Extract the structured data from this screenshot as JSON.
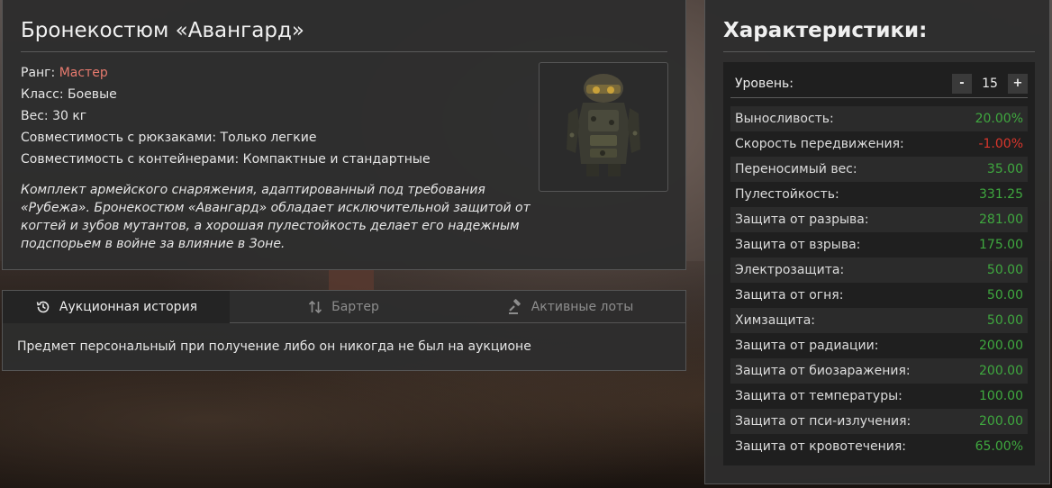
{
  "item": {
    "title": "Бронекостюм «Авангард»",
    "rank_label": "Ранг: ",
    "rank_value": "Мастер",
    "class_line": "Класс: Боевые",
    "weight_line": "Вес: 30 кг",
    "backpack_line": "Совместимость с рюкзаками: Только легкие",
    "container_line": "Совместимость с контейнерами: Компактные и стандартные",
    "description": "Комплект армейского снаряжения, адаптированный под требования «Рубежа». Бронекостюм «Авангард» обладает исключительной защитой от когтей и зубов мутантов, а хорошая пулестойкость делает его надежным подспорьем в войне за влияние в Зоне.",
    "image_icon": "armor-suit-icon"
  },
  "tabs": {
    "items": [
      {
        "label": "Аукционная история",
        "icon": "history-icon",
        "active": true
      },
      {
        "label": "Бартер",
        "icon": "swap-arrows-icon",
        "active": false
      },
      {
        "label": "Активные лоты",
        "icon": "gavel-icon",
        "active": false
      }
    ],
    "content": "Предмет персональный при получение либо он никогда не был на аукционе"
  },
  "characteristics": {
    "title": "Характеристики:",
    "level_label": "Уровень:",
    "level_value": "15",
    "minus_label": "-",
    "plus_label": "+",
    "stats": [
      {
        "name": "Выносливость:",
        "value": "20.00%"
      },
      {
        "name": "Скорость передвижения:",
        "value": "-1.00%"
      },
      {
        "name": "Переносимый вес:",
        "value": "35.00"
      },
      {
        "name": "Пулестойкость:",
        "value": "331.25"
      },
      {
        "name": "Защита от разрыва:",
        "value": "281.00"
      },
      {
        "name": "Защита от взрыва:",
        "value": "175.00"
      },
      {
        "name": "Электрозащита:",
        "value": "50.00"
      },
      {
        "name": "Защита от огня:",
        "value": "50.00"
      },
      {
        "name": "Химзащита:",
        "value": "50.00"
      },
      {
        "name": "Защита от радиации:",
        "value": "200.00"
      },
      {
        "name": "Защита от биозаражения:",
        "value": "200.00"
      },
      {
        "name": "Защита от температуры:",
        "value": "100.00"
      },
      {
        "name": "Защита от пси-излучения:",
        "value": "200.00"
      },
      {
        "name": "Защита от кровотечения:",
        "value": "65.00%"
      }
    ]
  },
  "colors": {
    "rank": "#e77a6e",
    "positive": "#3fa83f",
    "negative": "#d9362c",
    "panel_bg": "#2d2d2d"
  }
}
